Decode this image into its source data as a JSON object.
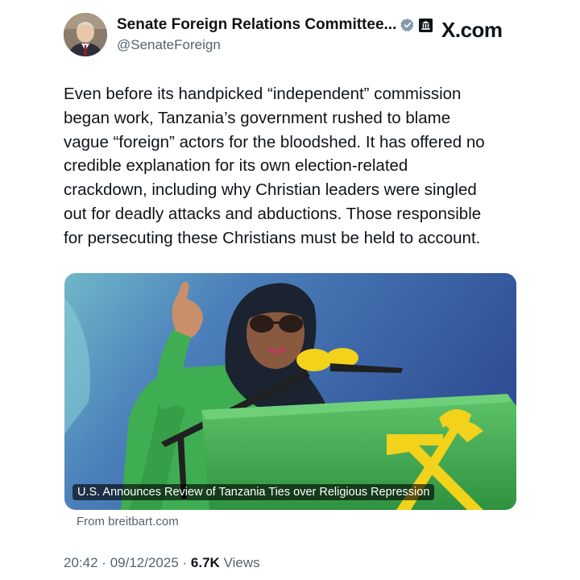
{
  "account": {
    "display_name": "Senate Foreign Relations Committee...",
    "handle": "@SenateForeign",
    "verified_badge_icon": "gray-verified-badge-icon",
    "affiliate_icon": "government-building-icon"
  },
  "site_label": "X.com",
  "tweet": {
    "text": "Even before its handpicked “independent” commission\nbegan work, Tanzania’s government rushed to blame\nvague “foreign” actors for the bloodshed. It has offered no\ncredible explanation for its own election-related\ncrackdown, including why Christian leaders were singled\nout for deadly attacks and abductions. Those responsible\nfor persecuting these Christians must be held to account."
  },
  "link_card": {
    "title": "U.S. Announces Review of Tanzania Ties over Religious Repression",
    "source": "From breitbart.com",
    "image": "woman-speaking-at-podium-photo"
  },
  "meta": {
    "time": "20:42",
    "date": "09/12/2025",
    "separator": "·",
    "views_count": "6.7K",
    "views_label": "Views"
  },
  "colors": {
    "text_primary": "#0f1419",
    "text_secondary": "#536471",
    "podium_green": "#3aa349",
    "emblem_yellow": "#f2d21b",
    "background_blue": "#3d6fb0"
  }
}
